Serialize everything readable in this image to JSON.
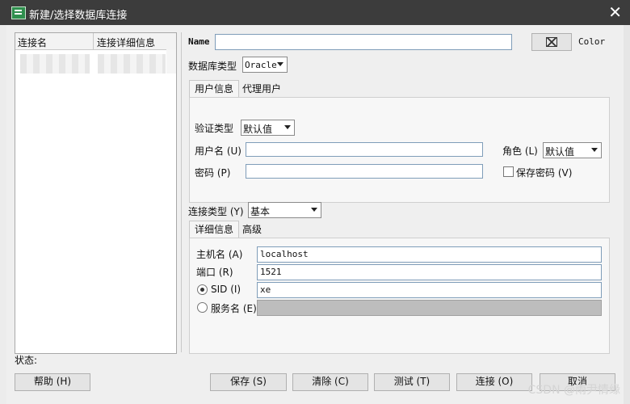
{
  "window": {
    "title": "新建/选择数据库连接"
  },
  "connections_list": {
    "columns": [
      "连接名",
      "连接详细信息"
    ]
  },
  "name_field": {
    "label": "Name",
    "value": ""
  },
  "color": {
    "label": "Color"
  },
  "db_type": {
    "label": "数据库类型",
    "value": "Oracle"
  },
  "user_tabs": [
    "用户信息",
    "代理用户"
  ],
  "auth": {
    "label": "验证类型",
    "value": "默认值"
  },
  "username": {
    "label": "用户名 (U)",
    "value": ""
  },
  "password": {
    "label": "密码 (P)",
    "value": ""
  },
  "role": {
    "label": "角色 (L)",
    "value": "默认值"
  },
  "save_password": {
    "label": "保存密码 (V)",
    "checked": false
  },
  "conn_type": {
    "label": "连接类型 (Y)",
    "value": "基本"
  },
  "detail_tabs": [
    "详细信息",
    "高级"
  ],
  "host": {
    "label": "主机名 (A)",
    "value": "localhost"
  },
  "port": {
    "label": "端口 (R)",
    "value": "1521"
  },
  "sid": {
    "label": "SID (I)",
    "value": "xe",
    "selected": true
  },
  "service": {
    "label": "服务名 (E)",
    "value": "",
    "selected": false
  },
  "status_label": "状态:",
  "buttons": {
    "help": "帮助 (H)",
    "save": "保存 (S)",
    "clear": "清除 (C)",
    "test": "测试 (T)",
    "connect": "连接 (O)",
    "cancel": "取消"
  },
  "watermark": "CSDN @雨尹情缘"
}
